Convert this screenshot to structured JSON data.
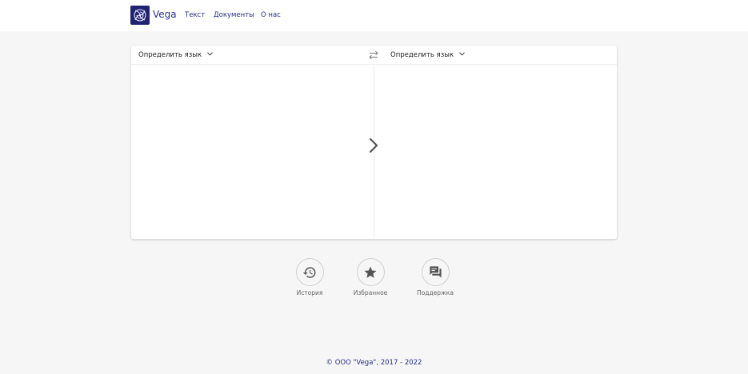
{
  "header": {
    "brand": "Vega",
    "nav": {
      "text": "Текст",
      "documents": "Документы",
      "about": "О нас"
    }
  },
  "translator": {
    "source_language": "Определить язык",
    "target_language": "Определить язык",
    "source_text": "",
    "target_text": ""
  },
  "actions": {
    "history": "История",
    "favorites": "Избранное",
    "support": "Поддержка"
  },
  "footer": {
    "copyright": "© ООО \"Vega\", 2017 - 2022"
  },
  "colors": {
    "brand": "#2a2f86",
    "logo_bg": "#1f2370",
    "page_bg": "#f6f6f6",
    "icon": "#555555"
  },
  "icons": [
    "vega-logo-icon",
    "chevron-down-icon",
    "swap-icon",
    "chevron-right-icon",
    "history-icon",
    "star-icon",
    "support-icon"
  ]
}
